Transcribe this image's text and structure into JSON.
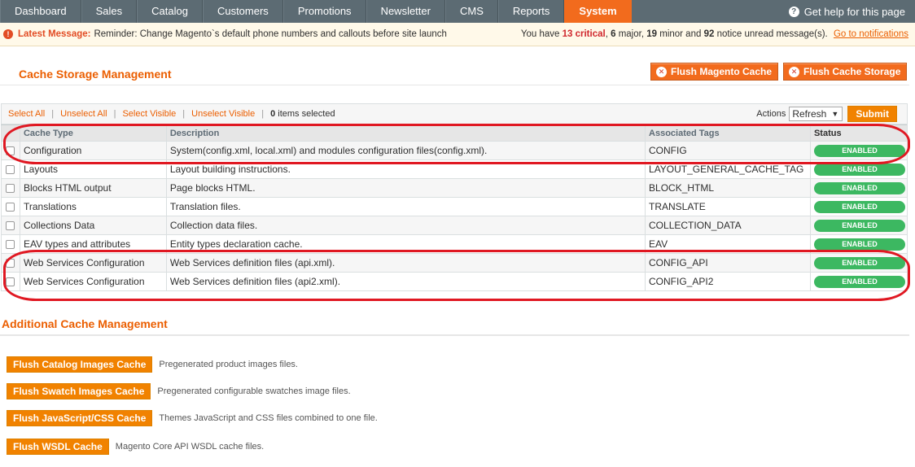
{
  "nav": {
    "items": [
      {
        "label": "Dashboard",
        "name": "nav-dashboard"
      },
      {
        "label": "Sales",
        "name": "nav-sales"
      },
      {
        "label": "Catalog",
        "name": "nav-catalog"
      },
      {
        "label": "Customers",
        "name": "nav-customers"
      },
      {
        "label": "Promotions",
        "name": "nav-promotions"
      },
      {
        "label": "Newsletter",
        "name": "nav-newsletter"
      },
      {
        "label": "CMS",
        "name": "nav-cms"
      },
      {
        "label": "Reports",
        "name": "nav-reports"
      },
      {
        "label": "System",
        "name": "nav-system",
        "active": true
      }
    ],
    "help_label": "Get help for this page",
    "help_icon": "help-icon"
  },
  "message": {
    "label": "Latest Message:",
    "text": "Reminder: Change Magento`s default phone numbers and callouts before site launch",
    "right_prefix": "You have",
    "critical": "13 critical",
    "major": "6",
    "major_label": "major,",
    "minor": "19",
    "minor_label": "minor and",
    "notice": "92",
    "notice_label": "notice unread message(s).",
    "link": "Go to notifications"
  },
  "page": {
    "title": "Cache Storage Management",
    "flush_magento": "Flush Magento Cache",
    "flush_storage": "Flush Cache Storage"
  },
  "toolbar": {
    "select_all": "Select All",
    "unselect_all": "Unselect All",
    "select_visible": "Select Visible",
    "unselect_visible": "Unselect Visible",
    "count": "0",
    "count_label": "items selected",
    "actions_label": "Actions",
    "action_value": "Refresh",
    "submit": "Submit"
  },
  "table": {
    "headers": [
      "Cache Type",
      "Description",
      "Associated Tags",
      "Status"
    ],
    "rows": [
      {
        "type": "Configuration",
        "desc": "System(config.xml, local.xml) and modules configuration files(config.xml).",
        "tags": "CONFIG",
        "status": "ENABLED"
      },
      {
        "type": "Layouts",
        "desc": "Layout building instructions.",
        "tags": "LAYOUT_GENERAL_CACHE_TAG",
        "status": "ENABLED"
      },
      {
        "type": "Blocks HTML output",
        "desc": "Page blocks HTML.",
        "tags": "BLOCK_HTML",
        "status": "ENABLED"
      },
      {
        "type": "Translations",
        "desc": "Translation files.",
        "tags": "TRANSLATE",
        "status": "ENABLED"
      },
      {
        "type": "Collections Data",
        "desc": "Collection data files.",
        "tags": "COLLECTION_DATA",
        "status": "ENABLED"
      },
      {
        "type": "EAV types and attributes",
        "desc": "Entity types declaration cache.",
        "tags": "EAV",
        "status": "ENABLED"
      },
      {
        "type": "Web Services Configuration",
        "desc": "Web Services definition files (api.xml).",
        "tags": "CONFIG_API",
        "status": "ENABLED"
      },
      {
        "type": "Web Services Configuration",
        "desc": "Web Services definition files (api2.xml).",
        "tags": "CONFIG_API2",
        "status": "ENABLED"
      }
    ]
  },
  "additional": {
    "title": "Additional Cache Management",
    "items": [
      {
        "button": "Flush Catalog Images Cache",
        "desc": "Pregenerated product images files."
      },
      {
        "button": "Flush Swatch Images Cache",
        "desc": "Pregenerated configurable swatches image files."
      },
      {
        "button": "Flush JavaScript/CSS Cache",
        "desc": "Themes JavaScript and CSS files combined to one file."
      },
      {
        "button": "Flush WSDL Cache",
        "desc": "Magento Core API WSDL cache files."
      }
    ]
  },
  "colors": {
    "accent": "#eb5e00",
    "nav_bg": "#5c6b73",
    "enabled": "#3cb861",
    "highlight": "#e01822"
  }
}
